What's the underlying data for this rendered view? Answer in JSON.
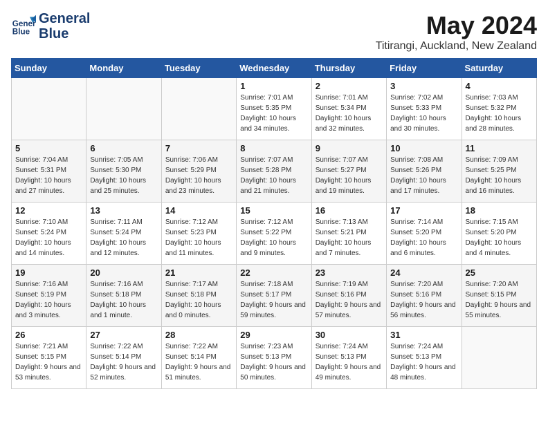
{
  "header": {
    "logo_line1": "General",
    "logo_line2": "Blue",
    "month": "May 2024",
    "location": "Titirangi, Auckland, New Zealand"
  },
  "weekdays": [
    "Sunday",
    "Monday",
    "Tuesday",
    "Wednesday",
    "Thursday",
    "Friday",
    "Saturday"
  ],
  "weeks": [
    [
      {
        "day": "",
        "sunrise": "",
        "sunset": "",
        "daylight": ""
      },
      {
        "day": "",
        "sunrise": "",
        "sunset": "",
        "daylight": ""
      },
      {
        "day": "",
        "sunrise": "",
        "sunset": "",
        "daylight": ""
      },
      {
        "day": "1",
        "sunrise": "Sunrise: 7:01 AM",
        "sunset": "Sunset: 5:35 PM",
        "daylight": "Daylight: 10 hours and 34 minutes."
      },
      {
        "day": "2",
        "sunrise": "Sunrise: 7:01 AM",
        "sunset": "Sunset: 5:34 PM",
        "daylight": "Daylight: 10 hours and 32 minutes."
      },
      {
        "day": "3",
        "sunrise": "Sunrise: 7:02 AM",
        "sunset": "Sunset: 5:33 PM",
        "daylight": "Daylight: 10 hours and 30 minutes."
      },
      {
        "day": "4",
        "sunrise": "Sunrise: 7:03 AM",
        "sunset": "Sunset: 5:32 PM",
        "daylight": "Daylight: 10 hours and 28 minutes."
      }
    ],
    [
      {
        "day": "5",
        "sunrise": "Sunrise: 7:04 AM",
        "sunset": "Sunset: 5:31 PM",
        "daylight": "Daylight: 10 hours and 27 minutes."
      },
      {
        "day": "6",
        "sunrise": "Sunrise: 7:05 AM",
        "sunset": "Sunset: 5:30 PM",
        "daylight": "Daylight: 10 hours and 25 minutes."
      },
      {
        "day": "7",
        "sunrise": "Sunrise: 7:06 AM",
        "sunset": "Sunset: 5:29 PM",
        "daylight": "Daylight: 10 hours and 23 minutes."
      },
      {
        "day": "8",
        "sunrise": "Sunrise: 7:07 AM",
        "sunset": "Sunset: 5:28 PM",
        "daylight": "Daylight: 10 hours and 21 minutes."
      },
      {
        "day": "9",
        "sunrise": "Sunrise: 7:07 AM",
        "sunset": "Sunset: 5:27 PM",
        "daylight": "Daylight: 10 hours and 19 minutes."
      },
      {
        "day": "10",
        "sunrise": "Sunrise: 7:08 AM",
        "sunset": "Sunset: 5:26 PM",
        "daylight": "Daylight: 10 hours and 17 minutes."
      },
      {
        "day": "11",
        "sunrise": "Sunrise: 7:09 AM",
        "sunset": "Sunset: 5:25 PM",
        "daylight": "Daylight: 10 hours and 16 minutes."
      }
    ],
    [
      {
        "day": "12",
        "sunrise": "Sunrise: 7:10 AM",
        "sunset": "Sunset: 5:24 PM",
        "daylight": "Daylight: 10 hours and 14 minutes."
      },
      {
        "day": "13",
        "sunrise": "Sunrise: 7:11 AM",
        "sunset": "Sunset: 5:24 PM",
        "daylight": "Daylight: 10 hours and 12 minutes."
      },
      {
        "day": "14",
        "sunrise": "Sunrise: 7:12 AM",
        "sunset": "Sunset: 5:23 PM",
        "daylight": "Daylight: 10 hours and 11 minutes."
      },
      {
        "day": "15",
        "sunrise": "Sunrise: 7:12 AM",
        "sunset": "Sunset: 5:22 PM",
        "daylight": "Daylight: 10 hours and 9 minutes."
      },
      {
        "day": "16",
        "sunrise": "Sunrise: 7:13 AM",
        "sunset": "Sunset: 5:21 PM",
        "daylight": "Daylight: 10 hours and 7 minutes."
      },
      {
        "day": "17",
        "sunrise": "Sunrise: 7:14 AM",
        "sunset": "Sunset: 5:20 PM",
        "daylight": "Daylight: 10 hours and 6 minutes."
      },
      {
        "day": "18",
        "sunrise": "Sunrise: 7:15 AM",
        "sunset": "Sunset: 5:20 PM",
        "daylight": "Daylight: 10 hours and 4 minutes."
      }
    ],
    [
      {
        "day": "19",
        "sunrise": "Sunrise: 7:16 AM",
        "sunset": "Sunset: 5:19 PM",
        "daylight": "Daylight: 10 hours and 3 minutes."
      },
      {
        "day": "20",
        "sunrise": "Sunrise: 7:16 AM",
        "sunset": "Sunset: 5:18 PM",
        "daylight": "Daylight: 10 hours and 1 minute."
      },
      {
        "day": "21",
        "sunrise": "Sunrise: 7:17 AM",
        "sunset": "Sunset: 5:18 PM",
        "daylight": "Daylight: 10 hours and 0 minutes."
      },
      {
        "day": "22",
        "sunrise": "Sunrise: 7:18 AM",
        "sunset": "Sunset: 5:17 PM",
        "daylight": "Daylight: 9 hours and 59 minutes."
      },
      {
        "day": "23",
        "sunrise": "Sunrise: 7:19 AM",
        "sunset": "Sunset: 5:16 PM",
        "daylight": "Daylight: 9 hours and 57 minutes."
      },
      {
        "day": "24",
        "sunrise": "Sunrise: 7:20 AM",
        "sunset": "Sunset: 5:16 PM",
        "daylight": "Daylight: 9 hours and 56 minutes."
      },
      {
        "day": "25",
        "sunrise": "Sunrise: 7:20 AM",
        "sunset": "Sunset: 5:15 PM",
        "daylight": "Daylight: 9 hours and 55 minutes."
      }
    ],
    [
      {
        "day": "26",
        "sunrise": "Sunrise: 7:21 AM",
        "sunset": "Sunset: 5:15 PM",
        "daylight": "Daylight: 9 hours and 53 minutes."
      },
      {
        "day": "27",
        "sunrise": "Sunrise: 7:22 AM",
        "sunset": "Sunset: 5:14 PM",
        "daylight": "Daylight: 9 hours and 52 minutes."
      },
      {
        "day": "28",
        "sunrise": "Sunrise: 7:22 AM",
        "sunset": "Sunset: 5:14 PM",
        "daylight": "Daylight: 9 hours and 51 minutes."
      },
      {
        "day": "29",
        "sunrise": "Sunrise: 7:23 AM",
        "sunset": "Sunset: 5:13 PM",
        "daylight": "Daylight: 9 hours and 50 minutes."
      },
      {
        "day": "30",
        "sunrise": "Sunrise: 7:24 AM",
        "sunset": "Sunset: 5:13 PM",
        "daylight": "Daylight: 9 hours and 49 minutes."
      },
      {
        "day": "31",
        "sunrise": "Sunrise: 7:24 AM",
        "sunset": "Sunset: 5:13 PM",
        "daylight": "Daylight: 9 hours and 48 minutes."
      },
      {
        "day": "",
        "sunrise": "",
        "sunset": "",
        "daylight": ""
      }
    ]
  ]
}
